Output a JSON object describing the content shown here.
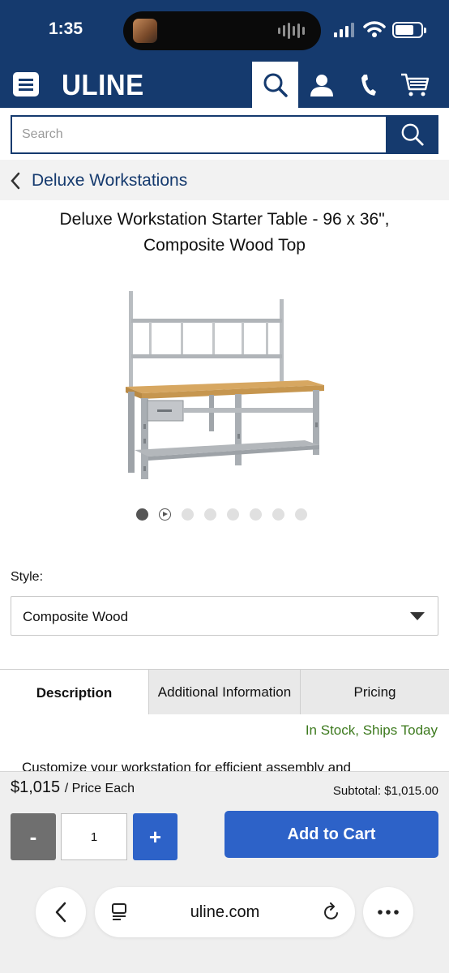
{
  "status_bar": {
    "time": "1:35"
  },
  "header": {
    "logo": "ULINE",
    "menu_icon": "hamburger-icon",
    "search_icon": "search-icon",
    "account_icon": "user-icon",
    "phone_icon": "phone-icon",
    "cart_icon": "cart-icon"
  },
  "search": {
    "placeholder": "Search",
    "value": ""
  },
  "breadcrumb": {
    "label": "Deluxe Workstations"
  },
  "product": {
    "title_line1": "Deluxe Workstation Starter Table - 96 x 36\",",
    "title_line2": "Composite Wood Top",
    "image_count": 8,
    "active_image": 1
  },
  "style": {
    "label": "Style:",
    "selected": "Composite Wood"
  },
  "tabs": [
    {
      "label": "Description",
      "active": true
    },
    {
      "label": "Additional Information",
      "active": false
    },
    {
      "label": "Pricing",
      "active": false
    }
  ],
  "stock_status": "In Stock, Ships Today",
  "description_snippet": "Customize your workstation for efficient assembly and",
  "cart": {
    "price": "$1,015",
    "price_unit": "/ Price Each",
    "subtotal": "Subtotal: $1,015.00",
    "minus_label": "-",
    "quantity": "1",
    "plus_label": "+",
    "add_to_cart_label": "Add to Cart"
  },
  "browser": {
    "url": "uline.com"
  },
  "colors": {
    "brand_navy": "#153a6e",
    "button_blue": "#2d62c8",
    "stock_green": "#3d7a1e"
  }
}
